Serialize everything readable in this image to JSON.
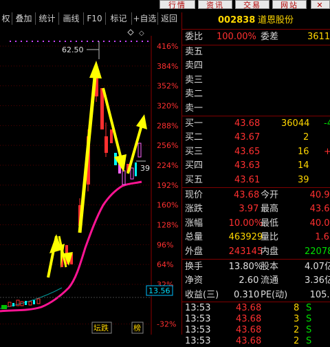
{
  "menu": {
    "items": [
      "行情",
      "资讯",
      "交易",
      "网站"
    ]
  },
  "toolbar": {
    "items": [
      "权",
      "叠加",
      "统计",
      "画线",
      "F10",
      "标记",
      "+自选",
      "返回"
    ]
  },
  "chart": {
    "y_ticks": [
      "416%",
      "384%",
      "352%",
      "320%",
      "288%",
      "256%",
      "224%",
      "192%",
      "160%",
      "128%",
      "96%",
      "64%",
      "32%",
      "-32%"
    ],
    "y_values": [
      416,
      384,
      352,
      320,
      288,
      256,
      224,
      192,
      160,
      128,
      96,
      64,
      32,
      -32
    ],
    "peak_label": "62.50",
    "current_label": "13.56",
    "right_marker": "39",
    "bottom_tags": [
      "坛跌",
      "榜"
    ],
    "colors": {
      "up": "#ff3030",
      "down": "#00ffff",
      "ma": "#ff1493",
      "arrow": "#ffff00",
      "grid": "#8b0000"
    }
  },
  "quote": {
    "code": "002838",
    "name": "道恩股份",
    "weibi_label": "委比",
    "weibi_value": "100.00%",
    "weicha_label": "委差",
    "weicha_value": "3611",
    "sell": [
      {
        "label": "卖五"
      },
      {
        "label": "卖四"
      },
      {
        "label": "卖三"
      },
      {
        "label": "卖二"
      },
      {
        "label": "卖一"
      }
    ],
    "buy": [
      {
        "label": "买一",
        "price": "43.68",
        "vol": "36044",
        "chg": "-4"
      },
      {
        "label": "买二",
        "price": "43.67",
        "vol": "2",
        "chg": ""
      },
      {
        "label": "买三",
        "price": "43.65",
        "vol": "16",
        "chg": "+"
      },
      {
        "label": "买四",
        "price": "43.63",
        "vol": "14",
        "chg": ""
      },
      {
        "label": "买五",
        "price": "43.61",
        "vol": "39",
        "chg": ""
      }
    ],
    "stats": [
      {
        "l1": "现价",
        "v1": "43.68",
        "l2": "今开",
        "v2": "40.9"
      },
      {
        "l1": "涨跌",
        "v1": "3.97",
        "l2": "最高",
        "v2": "43.6"
      },
      {
        "l1": "涨幅",
        "v1": "10.00%",
        "l2": "最低",
        "v2": "40.0"
      },
      {
        "l1": "总量",
        "v1": "463929",
        "l2": "量比",
        "v2": "1.6"
      },
      {
        "l1": "外盘",
        "v1": "243145",
        "l2": "内盘",
        "v2": "22078"
      }
    ],
    "stats2": [
      {
        "l1": "换手",
        "v1": "13.80%",
        "l2": "股本",
        "v2": "4.07亿"
      },
      {
        "l1": "净资",
        "v1": "2.60",
        "l2": "流通",
        "v2": "3.36亿"
      },
      {
        "l1": "收益(三)",
        "v1": "0.310",
        "l2": "PE(动)",
        "v2": "105."
      }
    ],
    "ticks": [
      {
        "time": "13:53",
        "price": "43.68",
        "vol": "8",
        "dir": "S"
      },
      {
        "time": "13:53",
        "price": "43.68",
        "vol": "3",
        "dir": "S"
      },
      {
        "time": "13:53",
        "price": "43.68",
        "vol": "2",
        "dir": "S"
      },
      {
        "time": "13:53",
        "price": "43.68",
        "vol": "2",
        "dir": "S"
      }
    ]
  }
}
